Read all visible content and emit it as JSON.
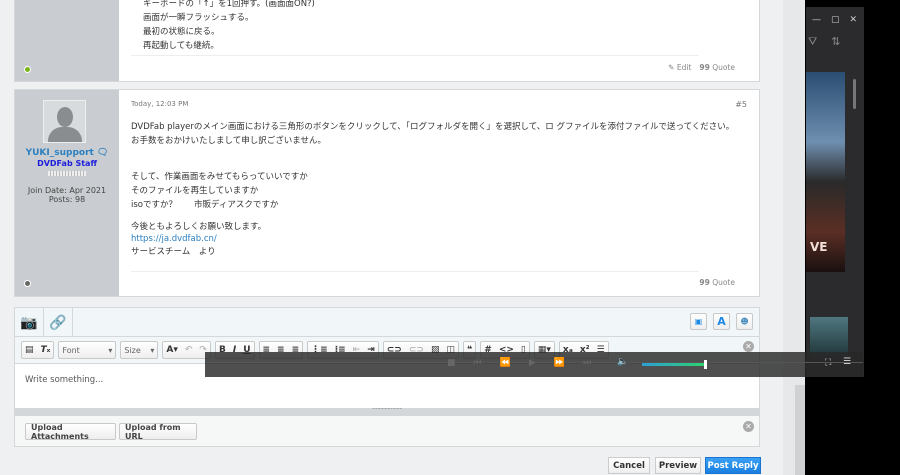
{
  "post1": {
    "lines": [
      "キーボードの「↑」を1回押す。(画面面ON?)",
      "画面が一瞬フラッシュする。",
      "最初の状態に戻る。",
      "再起動しても継続。"
    ],
    "edit": "Edit",
    "quote": "Quote"
  },
  "post2": {
    "time": "Today, 12:03 PM",
    "number": "#5",
    "username": "YUKI_support",
    "role": "DVDFab Staff",
    "join_date": "Join Date: Apr 2021",
    "posts": "Posts: 98",
    "lines": [
      "DVDFab playerのメイン画面における三角形のボタンをクリックして、「ログフォルダを開く」を選択して、ロ グファイルを添付ファイルで送ってください。",
      "お手数をおかけいたしまして申し訳ございません。",
      "",
      "",
      "そして、作業画面をみせてもらっていいですか",
      "そのファイルを再生していますか",
      "isoですか？　　市販ディアスクですか",
      "",
      "今後ともよろしくお願い致します。"
    ],
    "link": "https://ja.dvdfab.cn/",
    "sign": "サービスチーム　より",
    "quote": "Quote"
  },
  "editor": {
    "font": "Font",
    "size": "Size",
    "placeholder": "Write something...",
    "upload_attachments": "Upload Attachments",
    "upload_url": "Upload from URL"
  },
  "actions": {
    "cancel": "Cancel",
    "preview": "Preview",
    "post_reply": "Post Reply"
  },
  "player": {
    "volume": 0.95,
    "poster_text": "VE"
  },
  "colors": {
    "accent": "#1e88e5",
    "online": "#7cb518",
    "user": "#2c7fc0",
    "staff": "#1c1cdb"
  }
}
